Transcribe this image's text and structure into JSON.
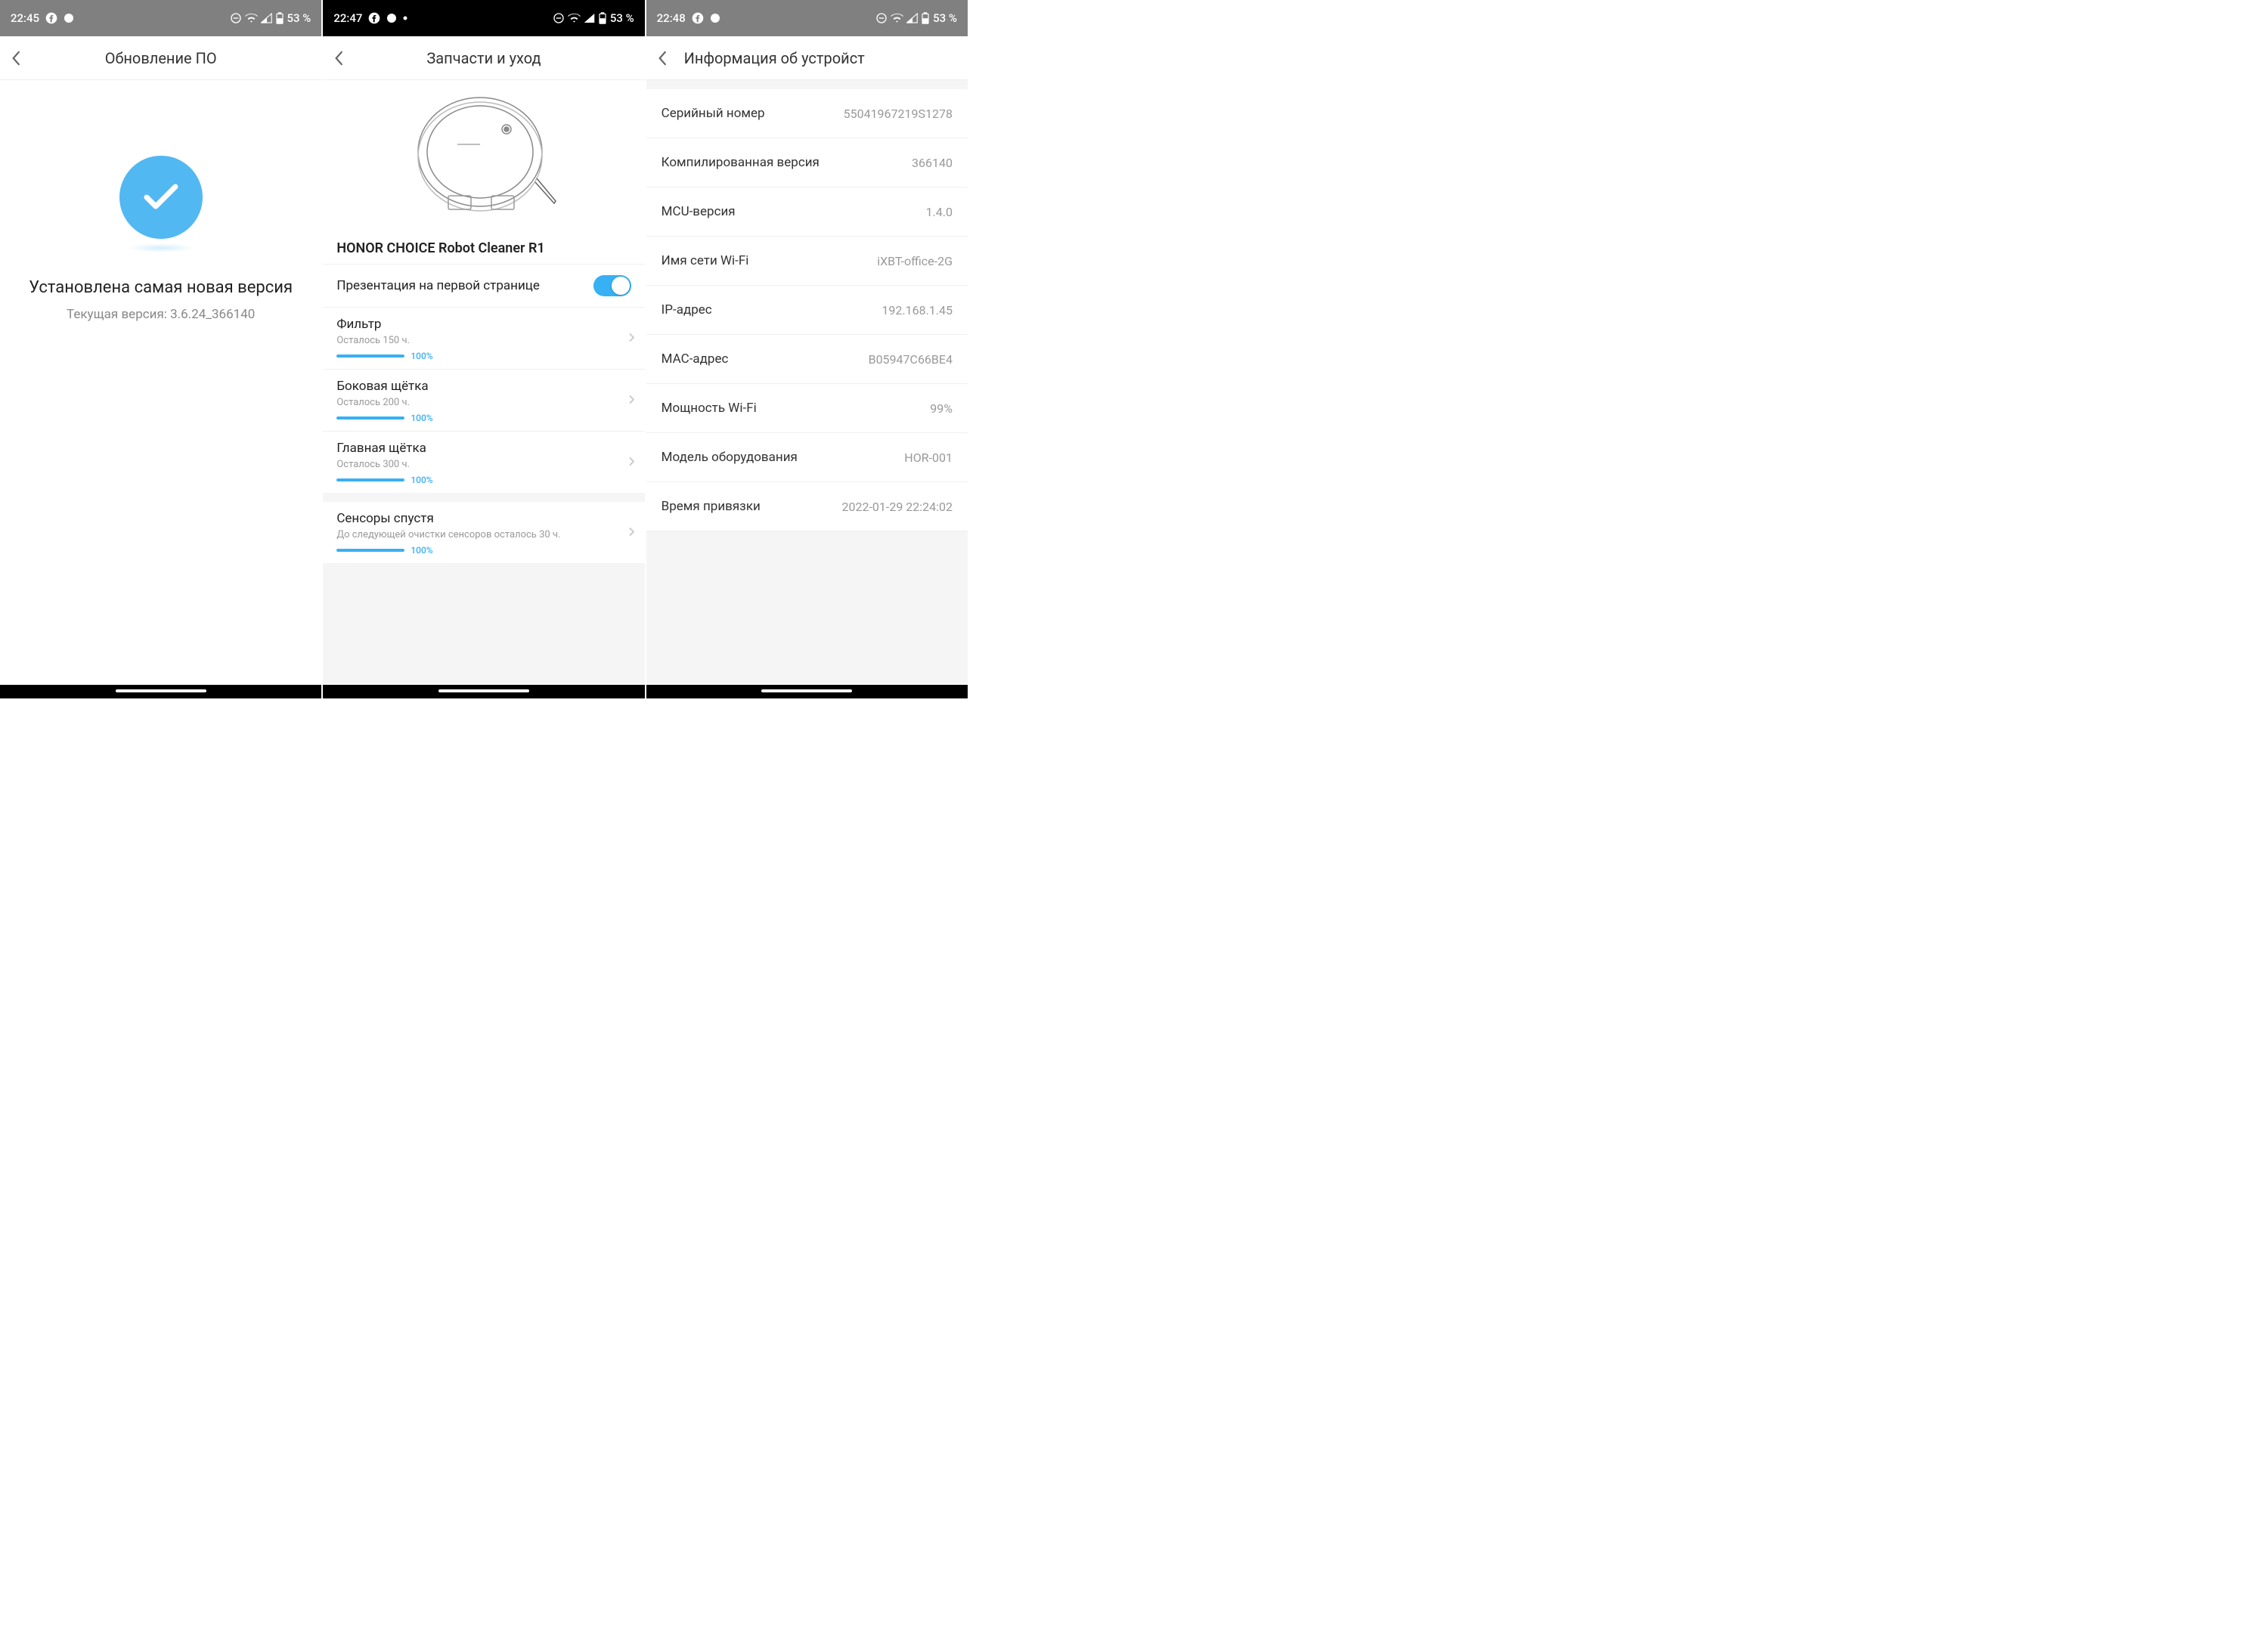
{
  "status": {
    "s1_time": "22:45",
    "s2_time": "22:47",
    "s3_time": "22:48",
    "battery": "53 %"
  },
  "screen1": {
    "title": "Обновление ПО",
    "headline": "Установлена самая новая версия",
    "subline": "Текущая версия: 3.6.24_366140"
  },
  "screen2": {
    "title": "Запчасти и уход",
    "product": "HONOR CHOICE Robot Cleaner R1",
    "toggle_label": "Презентация на первой странице",
    "parts": [
      {
        "name": "Фильтр",
        "remaining": "Осталось 150 ч.",
        "pct": "100%"
      },
      {
        "name": "Боковая щётка",
        "remaining": "Осталось 200 ч.",
        "pct": "100%"
      },
      {
        "name": "Главная щётка",
        "remaining": "Осталось 300 ч.",
        "pct": "100%"
      },
      {
        "name": "Сенсоры спустя",
        "remaining": "До следующей очистки сенсоров осталось 30 ч.",
        "pct": "100%"
      }
    ]
  },
  "screen3": {
    "title": "Информация об устройст",
    "rows": [
      {
        "label": "Серийный номер",
        "value": "55041967219S1278"
      },
      {
        "label": "Компилированная версия",
        "value": "366140"
      },
      {
        "label": "MCU-версия",
        "value": "1.4.0"
      },
      {
        "label": "Имя сети Wi-Fi",
        "value": "iXBT-office-2G"
      },
      {
        "label": "IP-адрес",
        "value": "192.168.1.45"
      },
      {
        "label": "MAC-адрес",
        "value": "B05947C66BE4"
      },
      {
        "label": "Мощность Wi-Fi",
        "value": "99%"
      },
      {
        "label": "Модель оборудования",
        "value": "HOR-001"
      },
      {
        "label": "Время привязки",
        "value": "2022-01-29 22:24:02"
      }
    ]
  }
}
